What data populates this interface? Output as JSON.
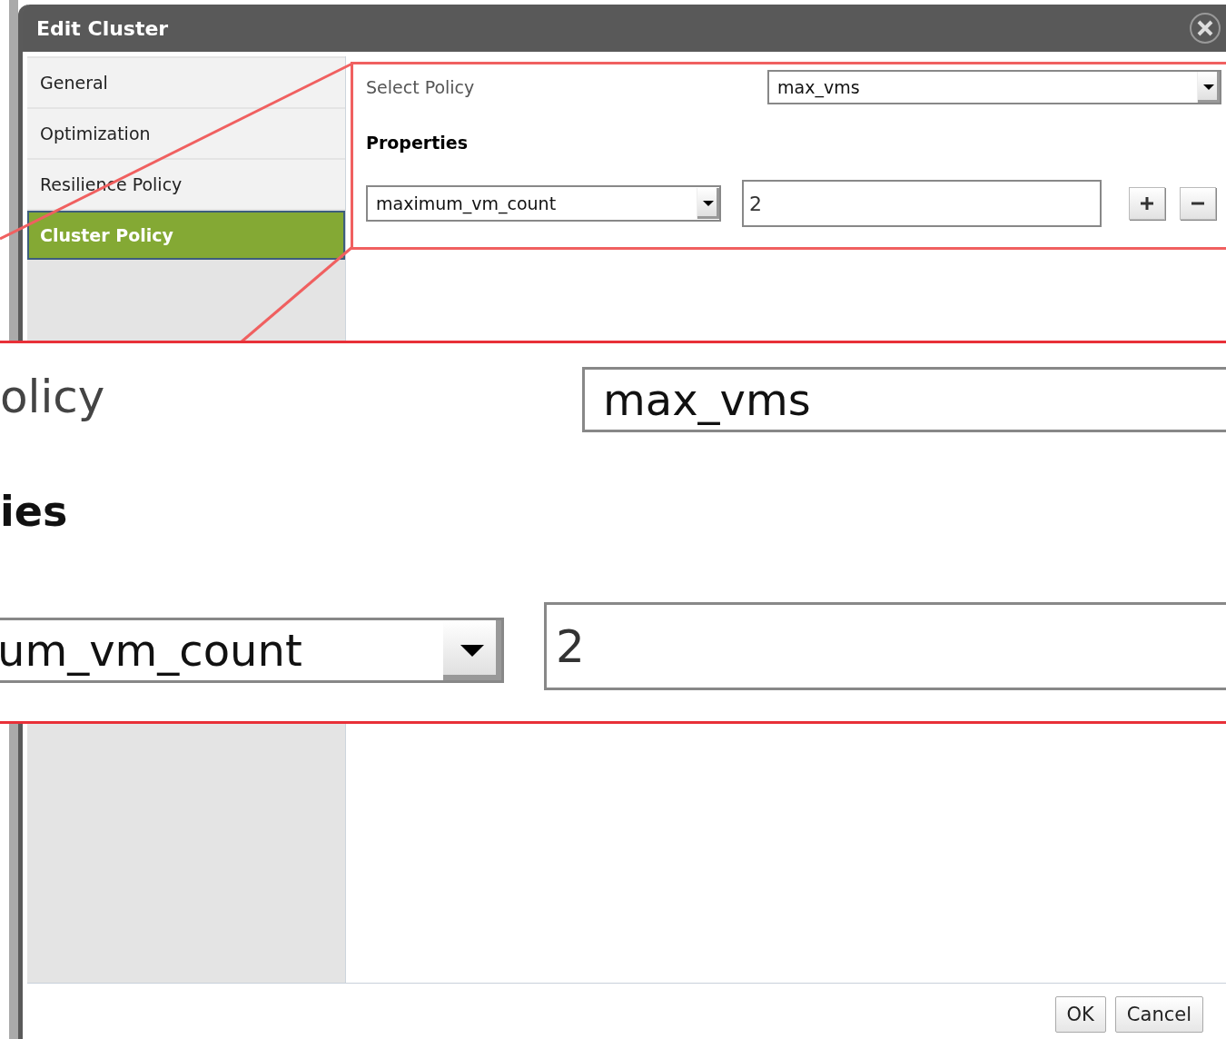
{
  "dialog": {
    "title": "Edit Cluster"
  },
  "sidebar": {
    "items": [
      {
        "label": "General",
        "selected": false
      },
      {
        "label": "Optimization",
        "selected": false
      },
      {
        "label": "Resilience Policy",
        "selected": false
      },
      {
        "label": "Cluster Policy",
        "selected": true
      }
    ]
  },
  "policy": {
    "label": "Select Policy",
    "value": "max_vms"
  },
  "properties": {
    "heading": "Properties",
    "rows": [
      {
        "key": "maximum_vm_count",
        "value": "2"
      }
    ]
  },
  "buttons": [
    "OK",
    "Cancel"
  ],
  "magnified_inset": {
    "label_fragment": "olicy",
    "policy_value": "max_vms",
    "heading_fragment": "ies",
    "key_fragment": "um_vm_count",
    "property_value": "2"
  }
}
